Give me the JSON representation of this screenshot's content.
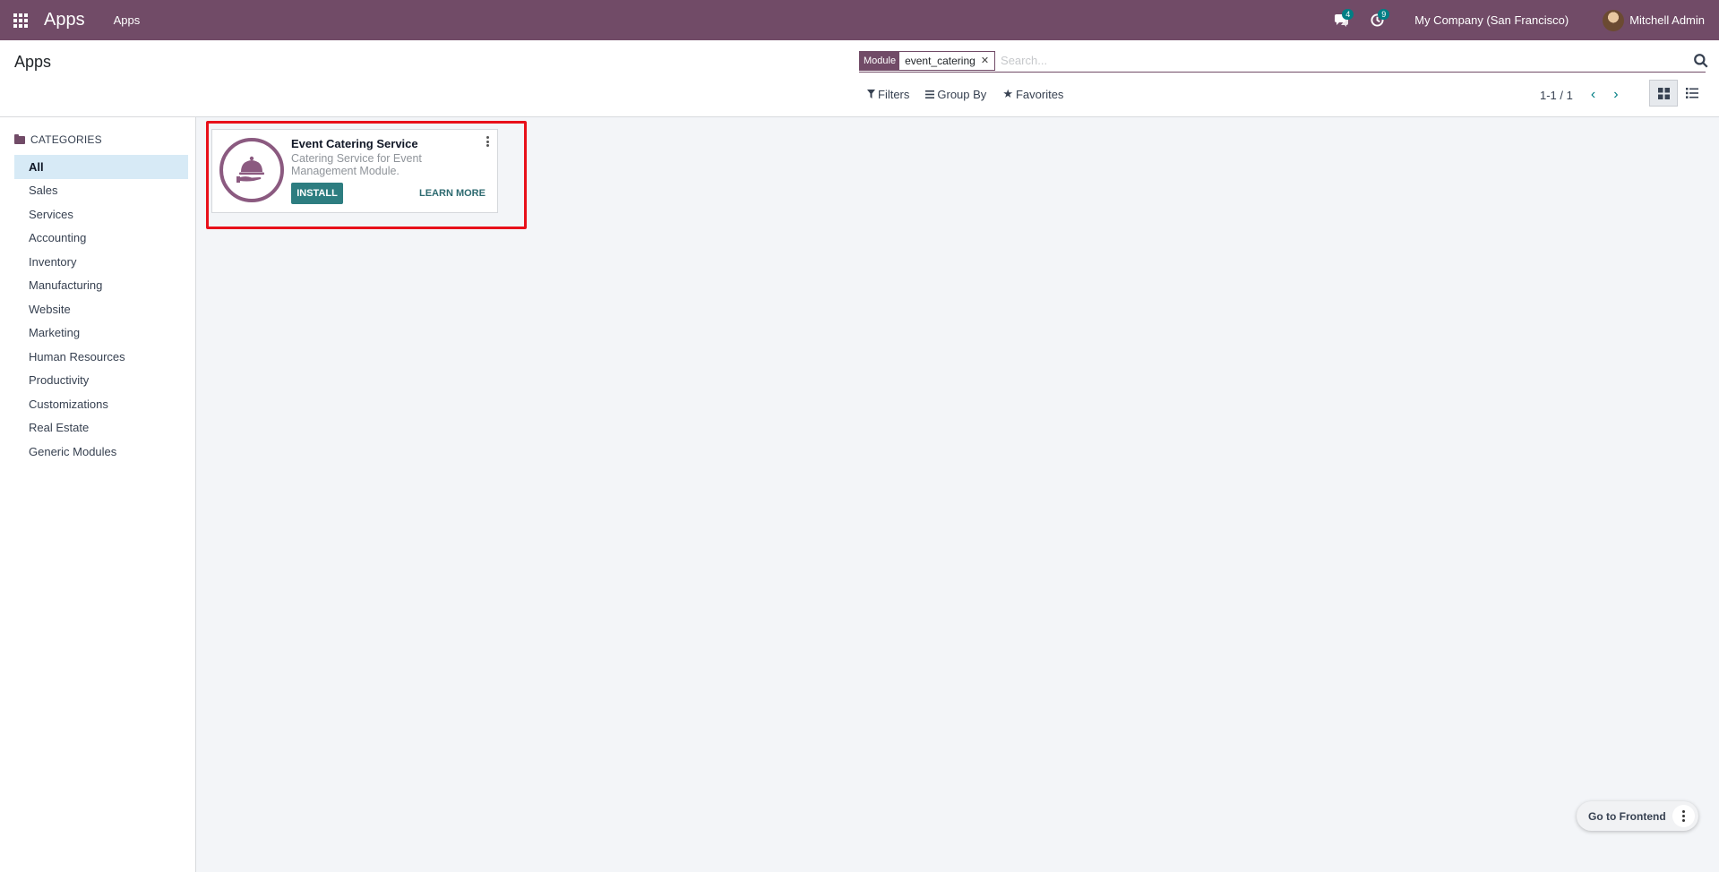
{
  "navbar": {
    "brand": "Apps",
    "menu_item": "Apps",
    "messages_badge": "4",
    "activities_badge": "9",
    "company": "My Company (San Francisco)",
    "user_name": "Mitchell Admin"
  },
  "control_panel": {
    "title": "Apps",
    "search": {
      "facet_label": "Module",
      "facet_value": "event_catering",
      "placeholder": "Search..."
    },
    "filters_label": "Filters",
    "groupby_label": "Group By",
    "favorites_label": "Favorites",
    "pager": "1-1 / 1"
  },
  "sidebar": {
    "header": "CATEGORIES",
    "items": [
      {
        "label": "All",
        "active": true
      },
      {
        "label": "Sales"
      },
      {
        "label": "Services"
      },
      {
        "label": "Accounting"
      },
      {
        "label": "Inventory"
      },
      {
        "label": "Manufacturing"
      },
      {
        "label": "Website"
      },
      {
        "label": "Marketing"
      },
      {
        "label": "Human Resources"
      },
      {
        "label": "Productivity"
      },
      {
        "label": "Customizations"
      },
      {
        "label": "Real Estate"
      },
      {
        "label": "Generic Modules"
      }
    ]
  },
  "module_card": {
    "title": "Event Catering Service",
    "description": "Catering Service for Event Management Module.",
    "install_label": "INSTALL",
    "learn_more_label": "LEARN MORE",
    "icon": "serving-cloche-icon"
  },
  "floating": {
    "go_to_frontend": "Go to Frontend"
  },
  "colors": {
    "brand": "#714b67",
    "accent": "#017e84",
    "highlight": "#e8101a"
  }
}
